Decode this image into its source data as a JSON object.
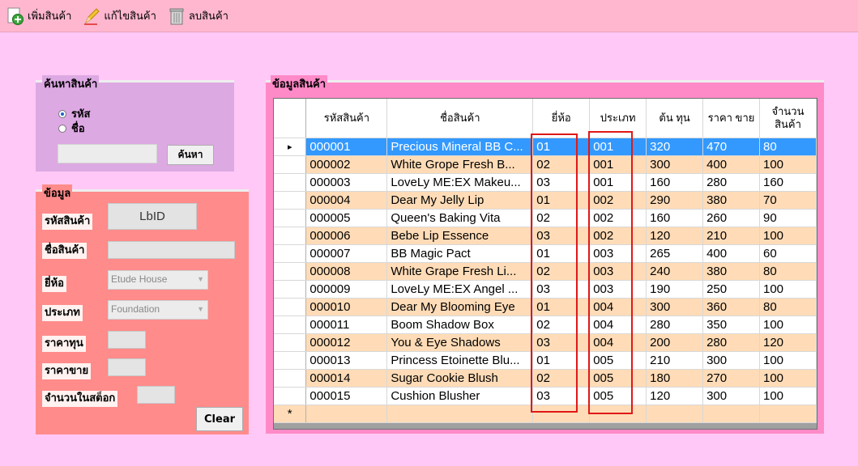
{
  "toolbar": {
    "add_label": "เพิ่มสินค้า",
    "edit_label": "แก้ไขสินค้า",
    "delete_label": "ลบสินค้า"
  },
  "search": {
    "title": "ค้นหาสินค้า",
    "radio_code": "รหัส",
    "radio_name": "ชื่อ",
    "selected": "รหัส",
    "input_value": "",
    "button_label": "ค้นหา"
  },
  "info": {
    "title": "ข้อมูล",
    "code_label": "รหัสสินค้า",
    "code_value": "LbID",
    "name_label": "ชื่อสินค้า",
    "name_value": "",
    "brand_label": "ยี่ห้อ",
    "brand_value": "Etude House",
    "type_label": "ประเภท",
    "type_value": "Foundation",
    "cost_label": "ราคาทุน",
    "cost_value": "",
    "price_label": "ราคาขาย",
    "price_value": "",
    "stock_label": "จำนวนในสต็อก",
    "stock_value": "",
    "clear_label": "Clear"
  },
  "grid": {
    "title": "ข้อมูลสินค้า",
    "headers": [
      "รหัสสินค้า",
      "ชื่อสินค้า",
      "ยี่ห้อ",
      "ประเภท",
      "ต้น ทุน",
      "ราคา ขาย",
      "จำนวน สินค้า"
    ],
    "selected_row": 0,
    "new_row_marker": "*",
    "current_row_marker": "▸",
    "rows": [
      [
        "000001",
        "Precious Mineral BB C...",
        "01",
        "001",
        "320",
        "470",
        "80"
      ],
      [
        "000002",
        "White Grope Fresh B...",
        "02",
        "001",
        "300",
        "400",
        "100"
      ],
      [
        "000003",
        "LoveLy ME:EX Makeu...",
        "03",
        "001",
        "160",
        "280",
        "160"
      ],
      [
        "000004",
        "Dear My Jelly Lip",
        "01",
        "002",
        "290",
        "380",
        "70"
      ],
      [
        "000005",
        "Queen's Baking Vita",
        "02",
        "002",
        "160",
        "260",
        "90"
      ],
      [
        "000006",
        "Bebe Lip Essence",
        "03",
        "002",
        "120",
        "210",
        "100"
      ],
      [
        "000007",
        "BB Magic Pact",
        "01",
        "003",
        "265",
        "400",
        "60"
      ],
      [
        "000008",
        "White Grape Fresh Li...",
        "02",
        "003",
        "240",
        "380",
        "80"
      ],
      [
        "000009",
        "LoveLy ME:EX Angel ...",
        "03",
        "003",
        "190",
        "250",
        "100"
      ],
      [
        "000010",
        "Dear My Blooming Eye",
        "01",
        "004",
        "300",
        "360",
        "80"
      ],
      [
        "000011",
        "Boom Shadow Box",
        "02",
        "004",
        "280",
        "350",
        "100"
      ],
      [
        "000012",
        "You & Eye Shadows",
        "03",
        "004",
        "200",
        "280",
        "120"
      ],
      [
        "000013",
        "Princess Etoinette Blu...",
        "01",
        "005",
        "210",
        "300",
        "100"
      ],
      [
        "000014",
        "Sugar Cookie Blush",
        "02",
        "005",
        "180",
        "270",
        "100"
      ],
      [
        "000015",
        "Cushion Blusher",
        "03",
        "005",
        "120",
        "300",
        "100"
      ]
    ]
  },
  "colors": {
    "background": "#ffc8f6",
    "toolbar": "#ffb7cf",
    "selected_row": "#3399ff",
    "alt_row": "#ffdcb7",
    "highlight_box": "#e01818"
  }
}
